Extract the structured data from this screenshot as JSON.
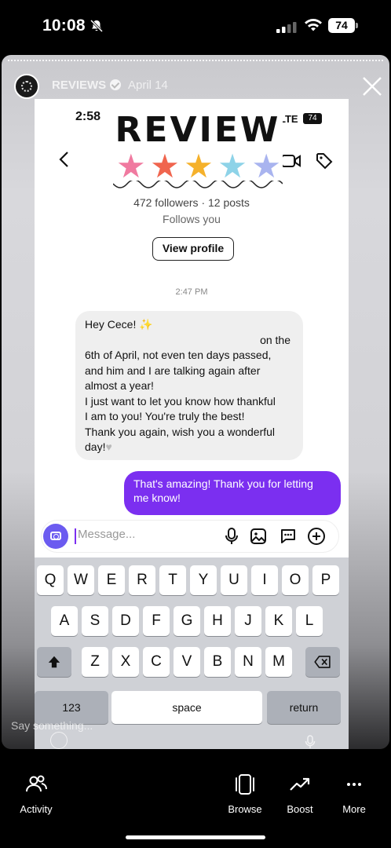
{
  "status": {
    "time": "10:08",
    "battery": "74"
  },
  "story": {
    "username": "REVIEWS",
    "date": "April 14",
    "reply_placeholder": "Say something..."
  },
  "inner": {
    "time": "2:58",
    "network": "LTE",
    "battery": "74",
    "sticker_title": "REVIEW",
    "star_colors": [
      "#f07aa0",
      "#f0654e",
      "#f5b12b",
      "#8ed3e8",
      "#a9b4ef"
    ],
    "followers_line": "472 followers · 12 posts",
    "follows_you": "Follows you",
    "view_profile": "View profile",
    "timestamp": "2:47 PM",
    "incoming_lines": [
      "Hey Cece!",
      "on the",
      "6th of April, not even ten days passed,",
      "and him and I are talking again after",
      "almost a year!",
      "I just want to let you know how thankful",
      "I am to you! You're truly the best!",
      "Thank you again, wish you a wonderful",
      "day!"
    ],
    "outgoing": "That's amazing! Thank you for letting me know!",
    "message_placeholder": "Message...",
    "keyboard": {
      "row1": [
        "Q",
        "W",
        "E",
        "R",
        "T",
        "Y",
        "U",
        "I",
        "O",
        "P"
      ],
      "row2": [
        "A",
        "S",
        "D",
        "F",
        "G",
        "H",
        "J",
        "K",
        "L"
      ],
      "row3": [
        "Z",
        "X",
        "C",
        "V",
        "B",
        "N",
        "M"
      ],
      "numbers": "123",
      "space": "space",
      "return": "return"
    }
  },
  "nav": {
    "activity": "Activity",
    "browse": "Browse",
    "boost": "Boost",
    "more": "More"
  }
}
